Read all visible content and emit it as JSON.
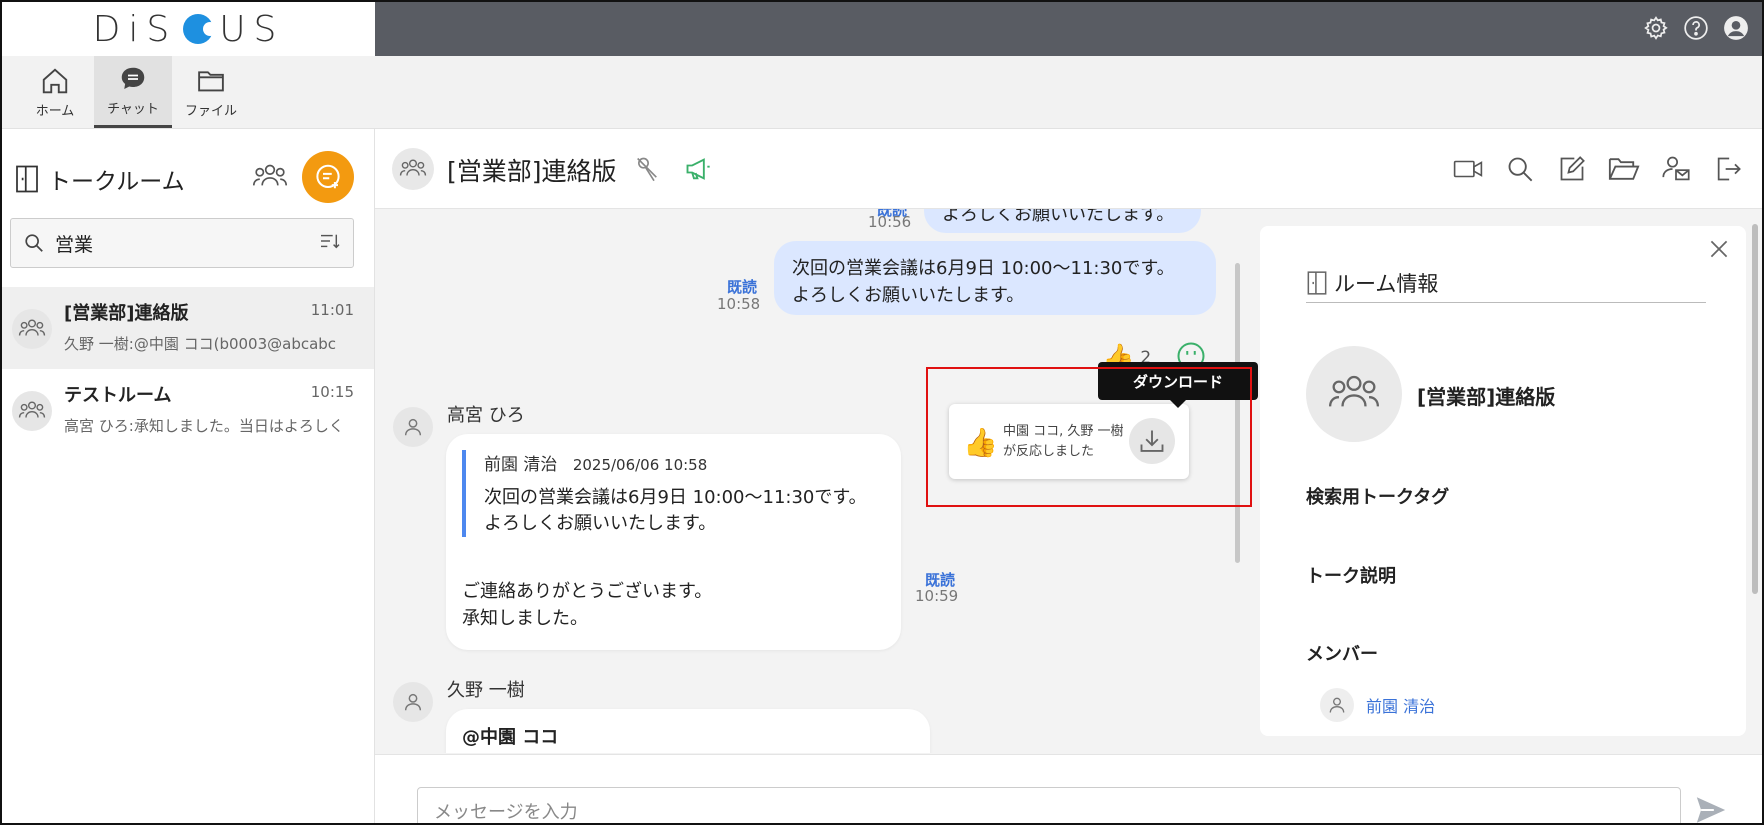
{
  "app": {
    "logo": "DiSCUS"
  },
  "nav": {
    "home": "ホーム",
    "chat": "チャット",
    "files": "ファイル"
  },
  "sidebar": {
    "title": "トークルーム",
    "search_value": "営業",
    "rooms": [
      {
        "name": "[営業部]連絡版",
        "time": "11:01",
        "preview": "久野 一樹:@中園 ココ(b0003@abcabc"
      },
      {
        "name": "テストルーム",
        "time": "10:15",
        "preview": "高宮 ひろ:承知しました。当日はよろしく"
      }
    ]
  },
  "chat": {
    "title": "[営業部]連絡版",
    "messages": {
      "top_read": "既読",
      "top_time": "10:56",
      "top_text": "よろしくお願いいたします。",
      "mine_text_line1": "次回の営業会議は6月9日 10:00～11:30です。",
      "mine_text_line2": "よろしくお願いいたします。",
      "mine_read": "既読",
      "mine_time": "10:58",
      "reaction_count": "2",
      "sender1_name": "高宮 ひろ",
      "quote_author": "前園 清治",
      "quote_date": "2025/06/06 10:58",
      "quote_line1": "次回の営業会議は6月9日 10:00～11:30です。",
      "quote_line2": "よろしくお願いいたします。",
      "reply_line1": "ご連絡ありがとうございます。",
      "reply_line2": "承知しました。",
      "reply_read": "既読",
      "reply_time": "10:59",
      "sender2_name": "久野 一樹",
      "sender2_text": "@中園 ココ"
    },
    "popup": {
      "text": "中園 ココ, 久野 一樹が反応しました",
      "tooltip": "ダウンロード"
    }
  },
  "room_info": {
    "title": "ルーム情報",
    "room_name": "[営業部]連絡版",
    "tags_label": "検索用トークタグ",
    "desc_label": "トーク説明",
    "members_label": "メンバー",
    "members": [
      "前園 清治"
    ]
  },
  "composer": {
    "placeholder": "メッセージを入力"
  },
  "colors": {
    "accent_orange": "#f39a10",
    "topbar": "#595c63",
    "bubble_mine": "#dbe7ff",
    "link_blue": "#3a72d8",
    "highlight_red": "#e01010"
  }
}
